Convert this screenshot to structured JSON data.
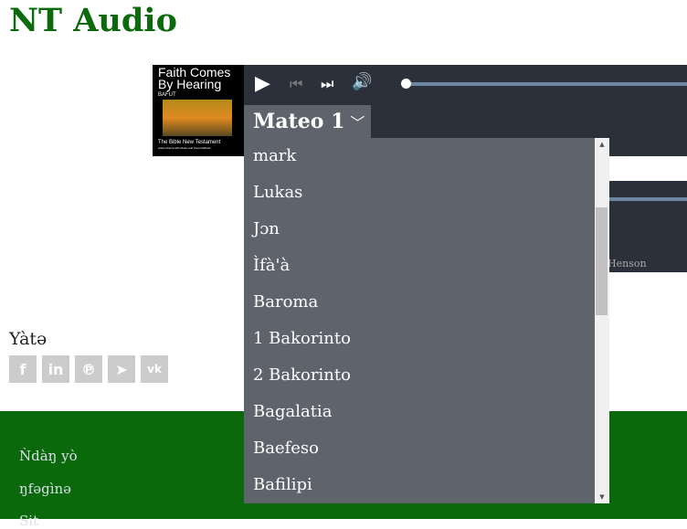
{
  "page": {
    "title": "NT Audio"
  },
  "player": {
    "art": {
      "line1": "Faith Comes By Hearing",
      "language": "BAFUT",
      "line2": "The Bible New Testament",
      "line3": "Audio Drama with Music and Sound Effects"
    },
    "progress": 0,
    "controls": [
      "play",
      "previous",
      "next",
      "volume"
    ]
  },
  "player2": {
    "credit": "Henson"
  },
  "chapter_select": {
    "selected": "Mateo 1",
    "options": [
      "mark",
      "Lukas",
      "Jɔn",
      "Ìfà'à",
      "Baroma",
      "1 Bakorinto",
      "2 Bakorinto",
      "Bagalatia",
      "Baefeso",
      "Bafilipi"
    ]
  },
  "share": {
    "label": "Yàtə",
    "icons": [
      "facebook",
      "linkedin",
      "pinterest",
      "telegram",
      "vk"
    ]
  },
  "footer": {
    "links": [
      "Ǹdàŋ yò",
      "ŋfəgìnə",
      "Sit"
    ]
  },
  "colors": {
    "title": "#0b6a0b",
    "footer": "#0a690a",
    "player": "#2b303b",
    "dropdown": "#5f636b"
  }
}
